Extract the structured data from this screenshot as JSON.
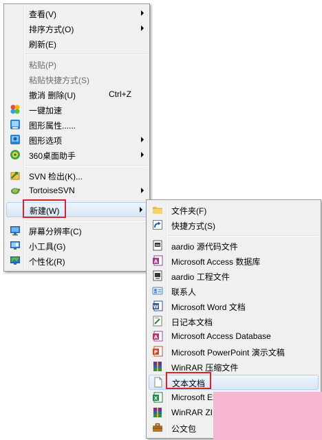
{
  "context_menu": {
    "items": [
      {
        "label": "查看(V)",
        "submenu": true
      },
      {
        "label": "排序方式(O)",
        "submenu": true
      },
      {
        "label": "刷新(E)"
      },
      {
        "label": "粘贴(P)",
        "disabled": true
      },
      {
        "label": "粘贴快捷方式(S)",
        "disabled": true
      },
      {
        "label": "撤消 删除(U)",
        "shortcut": "Ctrl+Z"
      },
      {
        "label": "一键加速",
        "icon": "speedup-icon"
      },
      {
        "label": "图形属性......",
        "icon": "graphics-properties-icon"
      },
      {
        "label": "图形选项",
        "icon": "graphics-options-icon",
        "submenu": true
      },
      {
        "label": "360桌面助手",
        "icon": "desktop-assistant-360-icon",
        "submenu": true
      },
      {
        "label": "SVN 检出(K)...",
        "icon": "svn-checkout-icon"
      },
      {
        "label": "TortoiseSVN",
        "icon": "tortoisesvn-icon",
        "submenu": true
      },
      {
        "label": "新建(W)",
        "submenu": true,
        "highlighted": true
      },
      {
        "label": "屏幕分辨率(C)",
        "icon": "screen-resolution-icon"
      },
      {
        "label": "小工具(G)",
        "icon": "gadgets-icon"
      },
      {
        "label": "个性化(R)",
        "icon": "personalize-icon"
      }
    ]
  },
  "new_submenu": {
    "items": [
      {
        "label": "文件夹(F)",
        "icon": "folder-icon"
      },
      {
        "label": "快捷方式(S)",
        "icon": "shortcut-icon"
      },
      {
        "label": "aardio 源代码文件",
        "icon": "aardio-source-icon"
      },
      {
        "label": "Microsoft Access 数据库",
        "icon": "access-db-icon"
      },
      {
        "label": "aardio 工程文件",
        "icon": "aardio-project-icon"
      },
      {
        "label": "联系人",
        "icon": "contact-icon"
      },
      {
        "label": "Microsoft Word 文档",
        "icon": "word-doc-icon"
      },
      {
        "label": "日记本文档",
        "icon": "journal-doc-icon"
      },
      {
        "label": "Microsoft Access Database",
        "icon": "access-database-icon"
      },
      {
        "label": "Microsoft PowerPoint 演示文稿",
        "icon": "powerpoint-icon"
      },
      {
        "label": "WinRAR 压缩文件",
        "icon": "winrar-archive-icon"
      },
      {
        "label": "文本文档",
        "icon": "text-document-icon",
        "highlighted": true
      },
      {
        "label": "Microsoft Ex",
        "icon": "excel-icon"
      },
      {
        "label": "WinRAR ZIP",
        "icon": "winrar-zip-icon"
      },
      {
        "label": "公文包",
        "icon": "briefcase-icon"
      }
    ]
  }
}
